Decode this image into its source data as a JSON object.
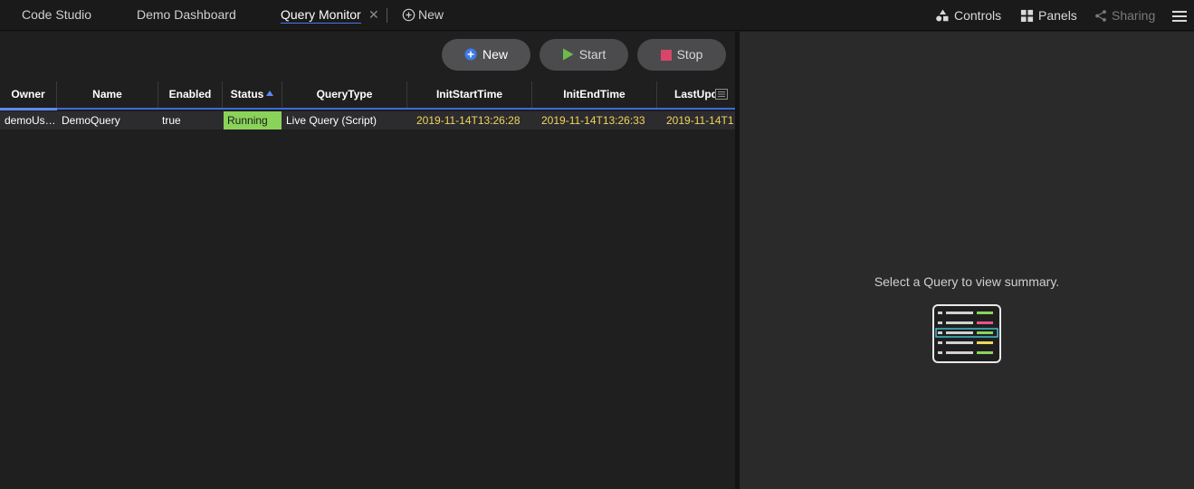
{
  "tabs": [
    {
      "label": "Code Studio",
      "active": false
    },
    {
      "label": "Demo Dashboard",
      "active": false
    },
    {
      "label": "Query Monitor",
      "active": true,
      "closable": true
    }
  ],
  "new_tab_label": "New",
  "top_actions": {
    "controls": "Controls",
    "panels": "Panels",
    "sharing": "Sharing"
  },
  "toolbar": {
    "new_label": "New",
    "start_label": "Start",
    "stop_label": "Stop"
  },
  "table": {
    "columns": [
      "Owner",
      "Name",
      "Enabled",
      "Status",
      "QueryType",
      "InitStartTime",
      "InitEndTime",
      "LastUpd"
    ],
    "sorted_column": "Status",
    "sort_direction": "ascending",
    "rows": [
      {
        "owner": "demoUs…",
        "name": "DemoQuery",
        "enabled": "true",
        "status": "Running",
        "query_type": "Live Query (Script)",
        "init_start_time": "2019-11-14T13:26:28",
        "init_end_time": "2019-11-14T13:26:33",
        "last_updated": "2019-11-14T1"
      }
    ]
  },
  "summary_panel": {
    "empty_message": "Select a Query to view summary."
  },
  "colors": {
    "accent": "#4878ea",
    "status_running": "#8ad35a",
    "date_text": "#f2d45c",
    "stop_icon": "#d9456a",
    "start_icon": "#6dbb4a",
    "new_icon": "#3d7be8"
  },
  "icons": [
    "plus-circle-icon",
    "shapes-icon",
    "panels-grid-icon",
    "share-icon",
    "hamburger-menu-icon",
    "play-icon",
    "stop-square-icon",
    "column-options-icon",
    "query-list-illustration-icon",
    "close-icon",
    "sort-ascending-icon"
  ]
}
